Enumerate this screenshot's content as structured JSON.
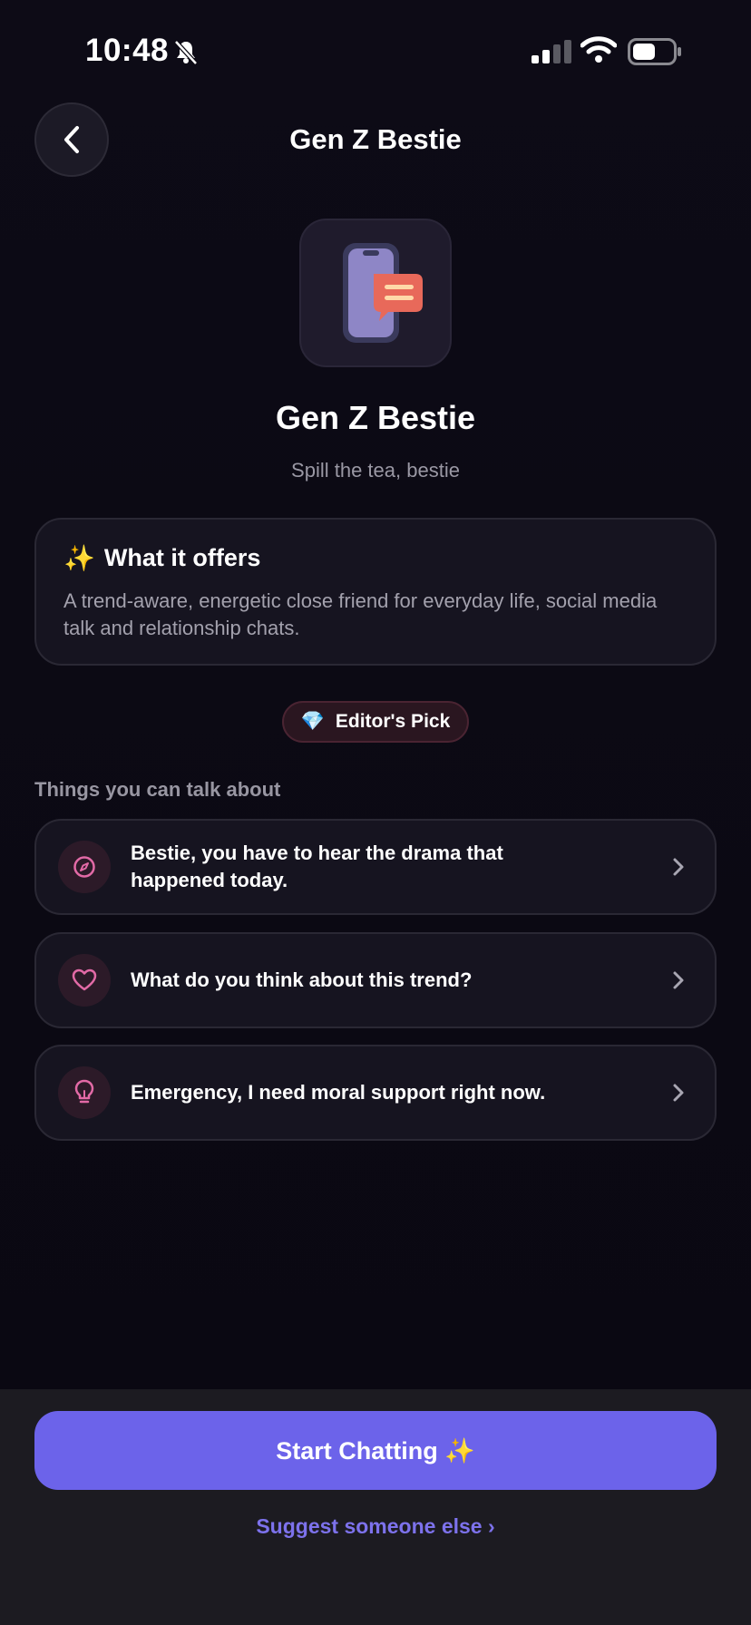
{
  "status_bar": {
    "time": "10:48"
  },
  "header": {
    "title": "Gen Z Bestie"
  },
  "profile": {
    "name": "Gen Z Bestie",
    "tagline": "Spill the tea, bestie"
  },
  "offers": {
    "emoji": "✨",
    "title": "What it offers",
    "description": "A trend-aware, energetic close friend for everyday life, social media talk and relationship chats."
  },
  "badge": {
    "emoji": "💎",
    "label": "Editor's Pick"
  },
  "topics": {
    "section_label": "Things you can talk about",
    "items": [
      {
        "icon": "compass-icon",
        "text": "Bestie, you have to hear the drama that happened today."
      },
      {
        "icon": "heart-icon",
        "text": "What do you think about this trend?"
      },
      {
        "icon": "lightbulb-icon",
        "text": "Emergency, I need moral support right now."
      }
    ]
  },
  "actions": {
    "start_label": "Start Chatting ✨",
    "suggest_label": "Suggest someone else ›"
  },
  "colors": {
    "accent": "#6c63ea",
    "link": "#7d72ec",
    "icon_pink": "#e26aa6"
  }
}
